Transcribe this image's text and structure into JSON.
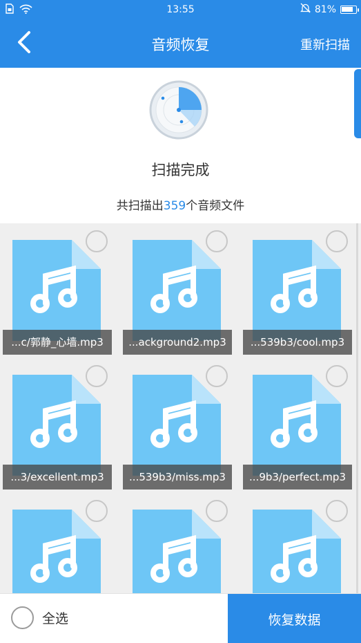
{
  "status_bar": {
    "time": "13:55",
    "battery_text": "81%",
    "battery_level": 0.81,
    "icons": [
      "sim-icon",
      "wifi-icon",
      "mute-icon",
      "battery-icon"
    ]
  },
  "nav": {
    "title": "音频恢复",
    "rescan_label": "重新扫描",
    "back_icon": "chevron-left-icon"
  },
  "scan": {
    "status": "扫描完成",
    "count_prefix": "共扫描出",
    "count": "359",
    "count_suffix": "个音频文件"
  },
  "files": [
    {
      "name": "...c/郭静_心墙.mp3"
    },
    {
      "name": "...ackground2.mp3"
    },
    {
      "name": "...539b3/cool.mp3"
    },
    {
      "name": "...3/excellent.mp3"
    },
    {
      "name": "...539b3/miss.mp3"
    },
    {
      "name": "...9b3/perfect.mp3"
    },
    {
      "name": ""
    },
    {
      "name": ""
    },
    {
      "name": ""
    }
  ],
  "bottom": {
    "select_all_label": "全选",
    "restore_label": "恢复数据"
  },
  "colors": {
    "accent": "#2a8be7",
    "file_icon": "#6ec6f6",
    "file_fold": "#b9e3fb"
  }
}
